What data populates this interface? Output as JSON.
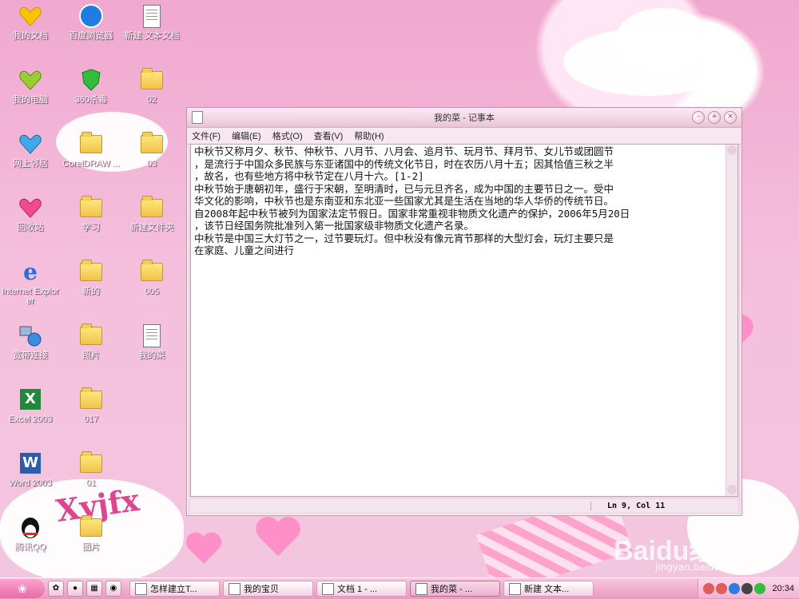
{
  "desktop_icons": [
    {
      "label": "我的文档",
      "type": "heart-gold"
    },
    {
      "label": "我的电脑",
      "type": "heart-green"
    },
    {
      "label": "网上邻居",
      "type": "heart-blue"
    },
    {
      "label": "回收站",
      "type": "heart-pink"
    },
    {
      "label": "Internet Explorer",
      "type": "ie"
    },
    {
      "label": "宽带连接",
      "type": "network"
    },
    {
      "label": "Excel 2003",
      "type": "excel"
    },
    {
      "label": "Word 2003",
      "type": "word"
    },
    {
      "label": "腾讯QQ",
      "type": "qq"
    },
    {
      "label": "百度浏览器",
      "type": "baidu"
    },
    {
      "label": "360杀毒",
      "type": "shield"
    },
    {
      "label": "CorelDRAW ...",
      "type": "folder"
    },
    {
      "label": "学习",
      "type": "folder"
    },
    {
      "label": "新的",
      "type": "folder"
    },
    {
      "label": "照片",
      "type": "folder"
    },
    {
      "label": "017",
      "type": "folder"
    },
    {
      "label": "01",
      "type": "folder"
    },
    {
      "label": "图片",
      "type": "folder"
    },
    {
      "label": "新建 文本文档",
      "type": "doc"
    },
    {
      "label": "02",
      "type": "folder"
    },
    {
      "label": "03",
      "type": "folder"
    },
    {
      "label": "新建文件夹",
      "type": "folder"
    },
    {
      "label": "005",
      "type": "folder"
    },
    {
      "label": "我的菜",
      "type": "doc"
    }
  ],
  "notepad": {
    "title": "我的菜 - 记事本",
    "menu": [
      "文件(F)",
      "编辑(E)",
      "格式(O)",
      "查看(V)",
      "帮助(H)"
    ],
    "content": [
      "中秋节又称月夕、秋节、仲秋节、八月节、八月会、追月节、玩月节、拜月节、女儿节或团圆节",
      "，是流行于中国众多民族与东亚诸国中的传统文化节日，时在农历八月十五；因其恰值三秋之半",
      "，故名，也有些地方将中秋节定在八月十六。[1-2]",
      "中秋节始于唐朝初年，盛行于宋朝，至明清时，已与元旦齐名，成为中国的主要节日之一。受中",
      "华文化的影响，中秋节也是东南亚和东北亚一些国家尤其是生活在当地的华人华侨的传统节日。",
      "自2008年起中秋节被列为国家法定节假日。国家非常重视非物质文化遗产的保护，2006年5月20日",
      "，该节日经国务院批准列入第一批国家级非物质文化遗产名录。",
      "中秋节是中国三大灯节之一，过节要玩灯。但中秋没有像元宵节那样的大型灯会，玩灯主要只是",
      "在家庭、儿童之间进行"
    ],
    "status": "Ln 9, Col 11"
  },
  "taskbar": {
    "tasks": [
      {
        "label": "怎样建立T...",
        "active": false
      },
      {
        "label": "我的宝贝",
        "active": false
      },
      {
        "label": "文档 1 - ...",
        "active": false
      },
      {
        "label": "我的菜 - ...",
        "active": true
      },
      {
        "label": "新建 文本...",
        "active": false
      }
    ],
    "clock": "20:34"
  },
  "watermark": {
    "brand": "Baidu经验",
    "url": "jingyan.baidu.com"
  },
  "colors": {
    "accent": "#e56ea7",
    "desktop": "#f3b8d8"
  }
}
